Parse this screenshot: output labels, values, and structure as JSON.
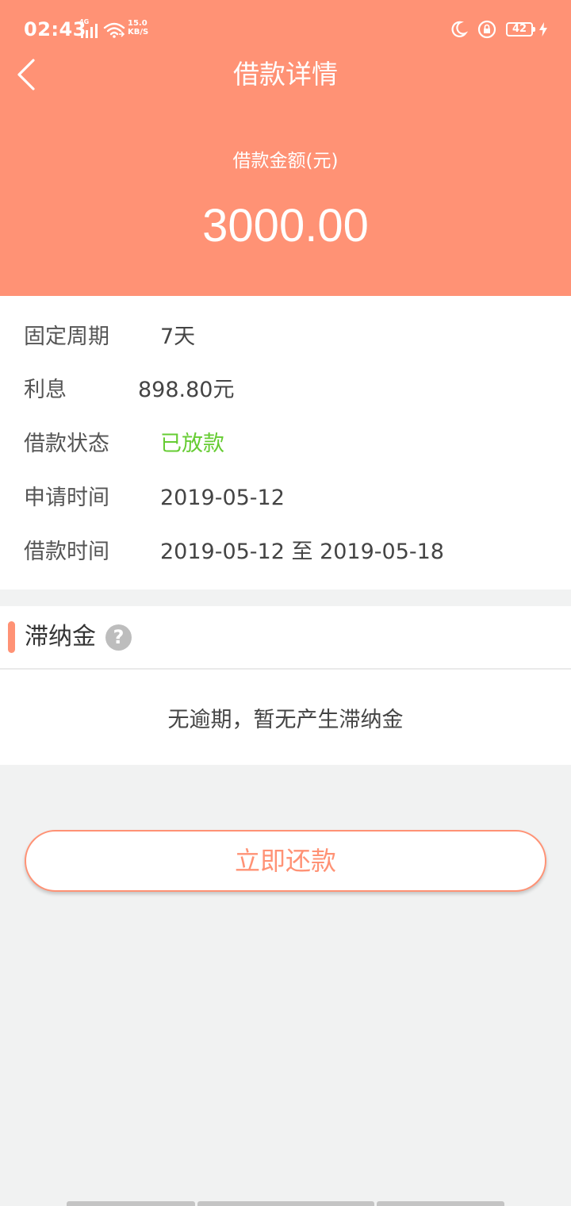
{
  "status_bar": {
    "time": "02:43",
    "network_type": "4G",
    "speed_value": "15.0",
    "speed_unit": "KB/S",
    "battery_level": "42",
    "icons": [
      "signal-icon",
      "wifi-icon",
      "moon-icon",
      "lock-rotation-icon",
      "battery-icon",
      "charging-icon"
    ]
  },
  "nav": {
    "back_icon": "chevron-left-icon",
    "title": "借款详情"
  },
  "summary": {
    "amount_label": "借款金额(元)",
    "amount_value": "3000.00"
  },
  "details": [
    {
      "label": "固定周期",
      "value": "7天"
    },
    {
      "label": "利息",
      "value": "898.80元"
    },
    {
      "label": "借款状态",
      "value": "已放款"
    },
    {
      "label": "申请时间",
      "value": "2019-05-12"
    },
    {
      "label": "借款时间",
      "value": "2019-05-12 至 2019-05-18"
    }
  ],
  "late_fee": {
    "title": "滞纳金",
    "help_icon": "question-circle-icon",
    "help_glyph": "?",
    "empty_text": "无逾期，暂无产生滞纳金"
  },
  "actions": {
    "repay_label": "立即还款"
  },
  "colors": {
    "accent": "#ff9275",
    "status_green": "#66cc33",
    "background": "#f1f2f2",
    "text_primary": "#333333"
  }
}
